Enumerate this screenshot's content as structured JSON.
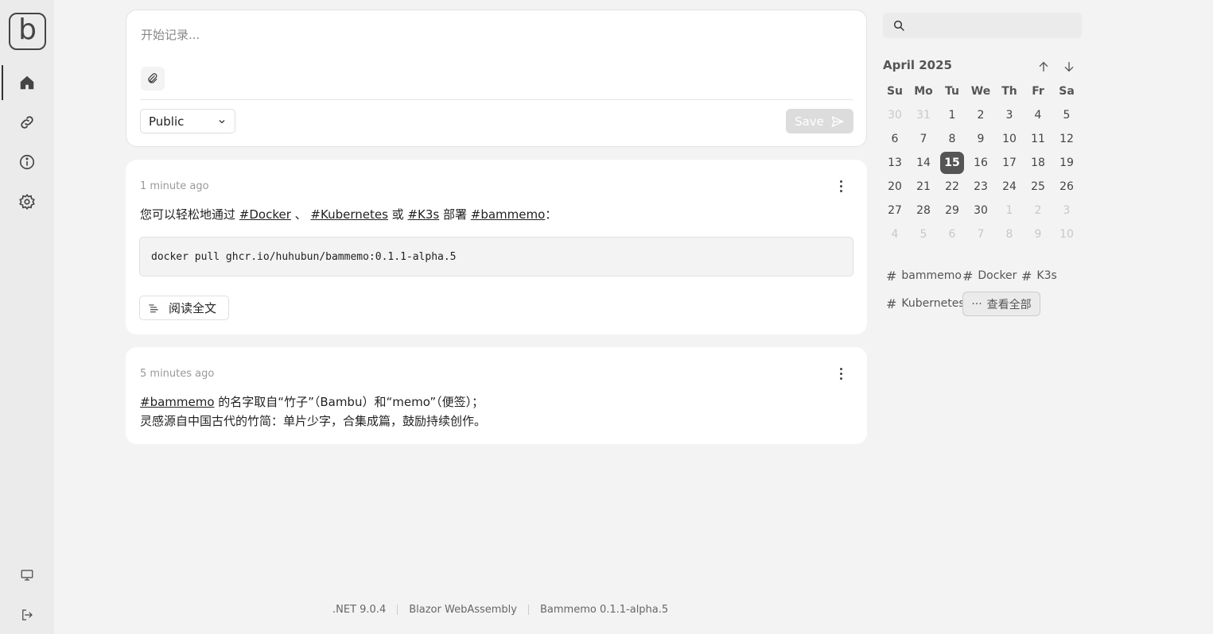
{
  "sidebar": {
    "logo_letter": "b",
    "items": [
      {
        "name": "home",
        "icon": "home-icon"
      },
      {
        "name": "links",
        "icon": "link-icon"
      },
      {
        "name": "about",
        "icon": "info-icon"
      },
      {
        "name": "settings",
        "icon": "gear-icon"
      }
    ],
    "bottom_items": [
      {
        "name": "display",
        "icon": "monitor-icon"
      },
      {
        "name": "logout",
        "icon": "logout-icon"
      }
    ]
  },
  "composer": {
    "placeholder": "开始记录...",
    "visibility": "Public",
    "save_label": "Save"
  },
  "memos": [
    {
      "time": "1 minute ago",
      "text_before": "您可以轻松地通过 ",
      "tag1": "#Docker",
      "sep1": " 、 ",
      "tag2": "#Kubernetes",
      "sep2": " 或 ",
      "tag3": "#K3s",
      "sep3": " 部署 ",
      "tag4": "#bammemo",
      "text_after": "：",
      "code": "docker pull ghcr.io/huhubun/bammemo:0.1.1-alpha.5",
      "read_more": "阅读全文"
    },
    {
      "time": "5 minutes ago",
      "tag": "#bammemo",
      "line1_rest": " 的名字取自“竹子”（Bambu）和“memo”（便签）；",
      "line2": "灵感源自中国古代的竹简：单片少字，合集成篇，鼓励持续创作。"
    }
  ],
  "search": {
    "placeholder": ""
  },
  "calendar": {
    "title": "April 2025",
    "weekdays": [
      "Su",
      "Mo",
      "Tu",
      "We",
      "Th",
      "Fr",
      "Sa"
    ],
    "weeks": [
      [
        {
          "d": "30",
          "out": true
        },
        {
          "d": "31",
          "out": true
        },
        {
          "d": "1"
        },
        {
          "d": "2"
        },
        {
          "d": "3"
        },
        {
          "d": "4"
        },
        {
          "d": "5"
        }
      ],
      [
        {
          "d": "6"
        },
        {
          "d": "7"
        },
        {
          "d": "8"
        },
        {
          "d": "9"
        },
        {
          "d": "10"
        },
        {
          "d": "11"
        },
        {
          "d": "12"
        }
      ],
      [
        {
          "d": "13"
        },
        {
          "d": "14"
        },
        {
          "d": "15",
          "today": true
        },
        {
          "d": "16"
        },
        {
          "d": "17"
        },
        {
          "d": "18"
        },
        {
          "d": "19"
        }
      ],
      [
        {
          "d": "20"
        },
        {
          "d": "21"
        },
        {
          "d": "22"
        },
        {
          "d": "23"
        },
        {
          "d": "24"
        },
        {
          "d": "25"
        },
        {
          "d": "26"
        }
      ],
      [
        {
          "d": "27"
        },
        {
          "d": "28"
        },
        {
          "d": "29"
        },
        {
          "d": "30"
        },
        {
          "d": "1",
          "out": true
        },
        {
          "d": "2",
          "out": true
        },
        {
          "d": "3",
          "out": true
        }
      ],
      [
        {
          "d": "4",
          "out": true
        },
        {
          "d": "5",
          "out": true
        },
        {
          "d": "6",
          "out": true
        },
        {
          "d": "7",
          "out": true
        },
        {
          "d": "8",
          "out": true
        },
        {
          "d": "9",
          "out": true
        },
        {
          "d": "10",
          "out": true
        }
      ]
    ]
  },
  "tags": {
    "items": [
      "bammemo",
      "Docker",
      "K3s",
      "Kubernetes"
    ],
    "view_all": "查看全部"
  },
  "footer": {
    "dotnet": ".NET 9.0.4",
    "blazor": "Blazor WebAssembly",
    "version": "Bammemo 0.1.1-alpha.5"
  },
  "colors": {
    "accent": "#555555",
    "background": "#f3f3f3",
    "sidebar": "#ebebeb"
  }
}
